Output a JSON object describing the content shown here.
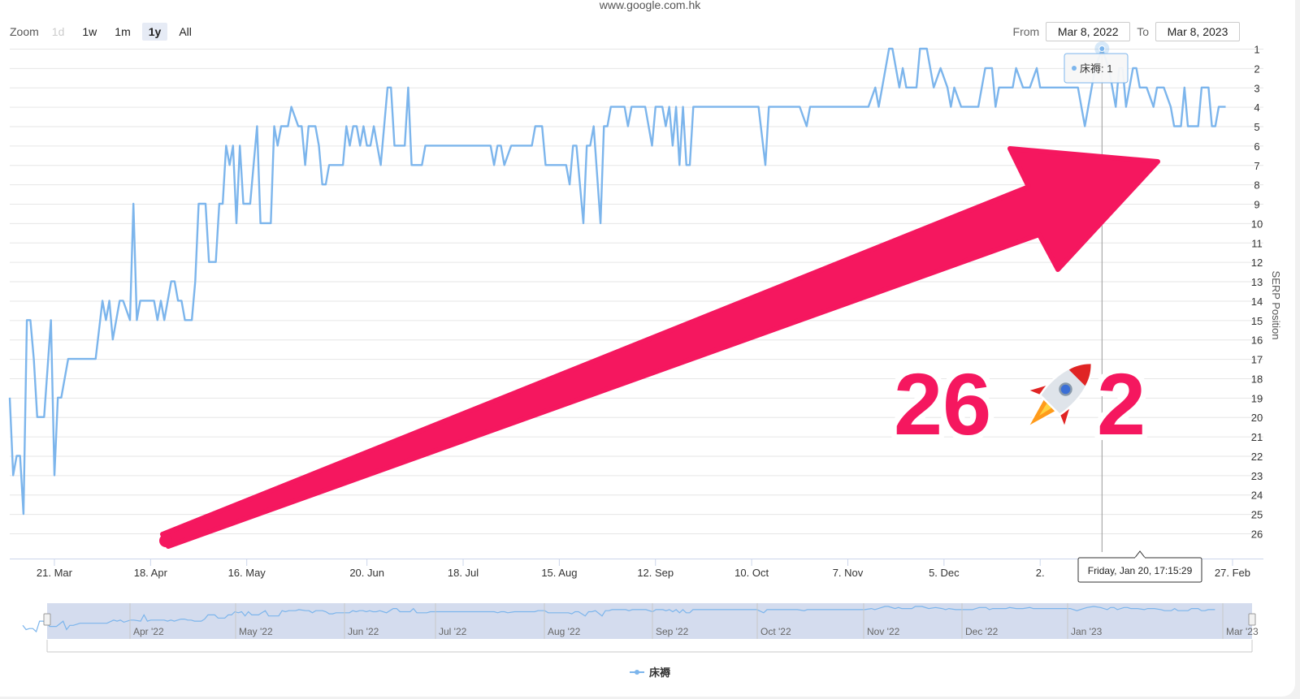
{
  "site_title": "www.google.com.hk",
  "zoom": {
    "label": "Zoom",
    "buttons": [
      {
        "label": "1d",
        "state": "disabled"
      },
      {
        "label": "1w",
        "state": "normal"
      },
      {
        "label": "1m",
        "state": "normal"
      },
      {
        "label": "1y",
        "state": "active"
      },
      {
        "label": "All",
        "state": "normal"
      }
    ]
  },
  "range": {
    "from_label": "From",
    "from_value": "Mar 8, 2022",
    "to_label": "To",
    "to_value": "Mar 8, 2023"
  },
  "tooltip": {
    "series_text": "床褥: 1",
    "date_text": "Friday, Jan 20, 17:15:29",
    "x": "2023-01-20",
    "y": 1
  },
  "overlay": {
    "left_number": "26",
    "right_number": "2",
    "rocket_icon": "rocket-icon",
    "arrow_color": "#f5175f"
  },
  "legend": {
    "label": "床褥"
  },
  "navigator": {
    "labels": [
      "Apr '22",
      "May '22",
      "Jun '22",
      "Jul '22",
      "Aug '22",
      "Sep '22",
      "Oct '22",
      "Nov '22",
      "Dec '22",
      "Jan '23",
      "Mar '23"
    ]
  },
  "chart_data": {
    "type": "line",
    "title": "",
    "ylabel": "SERP Position",
    "ylim": [
      1,
      26
    ],
    "y_reversed": true,
    "grid": true,
    "x_range": [
      "2022-03-08",
      "2023-03-08"
    ],
    "yticks": [
      1,
      2,
      3,
      4,
      5,
      6,
      7,
      8,
      9,
      10,
      11,
      12,
      13,
      14,
      15,
      16,
      17,
      18,
      19,
      20,
      21,
      22,
      23,
      24,
      25,
      26
    ],
    "xticks": [
      {
        "label": "21. Mar",
        "date": "2022-03-21"
      },
      {
        "label": "18. Apr",
        "date": "2022-04-18"
      },
      {
        "label": "16. May",
        "date": "2022-05-16"
      },
      {
        "label": "20. Jun",
        "date": "2022-06-20"
      },
      {
        "label": "18. Jul",
        "date": "2022-07-18"
      },
      {
        "label": "15. Aug",
        "date": "2022-08-15"
      },
      {
        "label": "12. Sep",
        "date": "2022-09-12"
      },
      {
        "label": "10. Oct",
        "date": "2022-10-10"
      },
      {
        "label": "7. Nov",
        "date": "2022-11-07"
      },
      {
        "label": "5. Dec",
        "date": "2022-12-05"
      },
      {
        "label": "2.",
        "date": "2023-01-02"
      },
      {
        "label": "27. Feb",
        "date": "2023-02-27"
      }
    ],
    "series": [
      {
        "name": "床褥",
        "color": "#7cb5ec",
        "points": [
          [
            "2022-03-08",
            19
          ],
          [
            "2022-03-09",
            23
          ],
          [
            "2022-03-10",
            22
          ],
          [
            "2022-03-11",
            22
          ],
          [
            "2022-03-12",
            25
          ],
          [
            "2022-03-13",
            15
          ],
          [
            "2022-03-14",
            15
          ],
          [
            "2022-03-15",
            17
          ],
          [
            "2022-03-16",
            20
          ],
          [
            "2022-03-17",
            20
          ],
          [
            "2022-03-18",
            20
          ],
          [
            "2022-03-20",
            15
          ],
          [
            "2022-03-21",
            23
          ],
          [
            "2022-03-22",
            19
          ],
          [
            "2022-03-23",
            19
          ],
          [
            "2022-03-25",
            17
          ],
          [
            "2022-04-02",
            17
          ],
          [
            "2022-04-04",
            14
          ],
          [
            "2022-04-05",
            15
          ],
          [
            "2022-04-06",
            14
          ],
          [
            "2022-04-07",
            16
          ],
          [
            "2022-04-09",
            14
          ],
          [
            "2022-04-10",
            14
          ],
          [
            "2022-04-12",
            15
          ],
          [
            "2022-04-13",
            9
          ],
          [
            "2022-04-14",
            15
          ],
          [
            "2022-04-15",
            14
          ],
          [
            "2022-04-19",
            14
          ],
          [
            "2022-04-20",
            15
          ],
          [
            "2022-04-21",
            14
          ],
          [
            "2022-04-22",
            15
          ],
          [
            "2022-04-24",
            13
          ],
          [
            "2022-04-25",
            13
          ],
          [
            "2022-04-26",
            14
          ],
          [
            "2022-04-27",
            14
          ],
          [
            "2022-04-28",
            15
          ],
          [
            "2022-04-30",
            15
          ],
          [
            "2022-05-01",
            13
          ],
          [
            "2022-05-02",
            9
          ],
          [
            "2022-05-04",
            9
          ],
          [
            "2022-05-05",
            12
          ],
          [
            "2022-05-07",
            12
          ],
          [
            "2022-05-08",
            9
          ],
          [
            "2022-05-09",
            9
          ],
          [
            "2022-05-10",
            6
          ],
          [
            "2022-05-11",
            7
          ],
          [
            "2022-05-12",
            6
          ],
          [
            "2022-05-13",
            10
          ],
          [
            "2022-05-14",
            6
          ],
          [
            "2022-05-15",
            9
          ],
          [
            "2022-05-17",
            9
          ],
          [
            "2022-05-18",
            7
          ],
          [
            "2022-05-19",
            5
          ],
          [
            "2022-05-20",
            10
          ],
          [
            "2022-05-23",
            10
          ],
          [
            "2022-05-24",
            5
          ],
          [
            "2022-05-25",
            6
          ],
          [
            "2022-05-26",
            5
          ],
          [
            "2022-05-28",
            5
          ],
          [
            "2022-05-29",
            4
          ],
          [
            "2022-05-31",
            5
          ],
          [
            "2022-06-01",
            5
          ],
          [
            "2022-06-02",
            7
          ],
          [
            "2022-06-03",
            5
          ],
          [
            "2022-06-05",
            5
          ],
          [
            "2022-06-06",
            6
          ],
          [
            "2022-06-07",
            8
          ],
          [
            "2022-06-08",
            8
          ],
          [
            "2022-06-09",
            7
          ],
          [
            "2022-06-13",
            7
          ],
          [
            "2022-06-14",
            5
          ],
          [
            "2022-06-15",
            6
          ],
          [
            "2022-06-16",
            5
          ],
          [
            "2022-06-17",
            5
          ],
          [
            "2022-06-18",
            6
          ],
          [
            "2022-06-19",
            5
          ],
          [
            "2022-06-20",
            6
          ],
          [
            "2022-06-21",
            6
          ],
          [
            "2022-06-22",
            5
          ],
          [
            "2022-06-23",
            6
          ],
          [
            "2022-06-24",
            7
          ],
          [
            "2022-06-26",
            3
          ],
          [
            "2022-06-27",
            3
          ],
          [
            "2022-06-28",
            6
          ],
          [
            "2022-07-01",
            6
          ],
          [
            "2022-07-02",
            3
          ],
          [
            "2022-07-03",
            7
          ],
          [
            "2022-07-06",
            7
          ],
          [
            "2022-07-07",
            6
          ],
          [
            "2022-07-26",
            6
          ],
          [
            "2022-07-27",
            7
          ],
          [
            "2022-07-28",
            6
          ],
          [
            "2022-07-29",
            6
          ],
          [
            "2022-07-30",
            7
          ],
          [
            "2022-08-01",
            6
          ],
          [
            "2022-08-07",
            6
          ],
          [
            "2022-08-08",
            5
          ],
          [
            "2022-08-10",
            5
          ],
          [
            "2022-08-11",
            7
          ],
          [
            "2022-08-17",
            7
          ],
          [
            "2022-08-18",
            8
          ],
          [
            "2022-08-19",
            6
          ],
          [
            "2022-08-20",
            6
          ],
          [
            "2022-08-22",
            10
          ],
          [
            "2022-08-23",
            6
          ],
          [
            "2022-08-24",
            6
          ],
          [
            "2022-08-25",
            5
          ],
          [
            "2022-08-27",
            10
          ],
          [
            "2022-08-28",
            5
          ],
          [
            "2022-08-29",
            5
          ],
          [
            "2022-08-30",
            4
          ],
          [
            "2022-09-03",
            4
          ],
          [
            "2022-09-04",
            5
          ],
          [
            "2022-09-05",
            4
          ],
          [
            "2022-09-09",
            4
          ],
          [
            "2022-09-11",
            6
          ],
          [
            "2022-09-12",
            4
          ],
          [
            "2022-09-14",
            4
          ],
          [
            "2022-09-15",
            5
          ],
          [
            "2022-09-16",
            4
          ],
          [
            "2022-09-17",
            6
          ],
          [
            "2022-09-18",
            4
          ],
          [
            "2022-09-19",
            7
          ],
          [
            "2022-09-20",
            4
          ],
          [
            "2022-09-21",
            7
          ],
          [
            "2022-09-22",
            7
          ],
          [
            "2022-09-23",
            4
          ],
          [
            "2022-10-12",
            4
          ],
          [
            "2022-10-14",
            7
          ],
          [
            "2022-10-15",
            4
          ],
          [
            "2022-10-24",
            4
          ],
          [
            "2022-10-26",
            5
          ],
          [
            "2022-10-27",
            4
          ],
          [
            "2022-11-13",
            4
          ],
          [
            "2022-11-15",
            3
          ],
          [
            "2022-11-16",
            4
          ],
          [
            "2022-11-18",
            2
          ],
          [
            "2022-11-19",
            1
          ],
          [
            "2022-11-20",
            1
          ],
          [
            "2022-11-22",
            3
          ],
          [
            "2022-11-23",
            2
          ],
          [
            "2022-11-24",
            3
          ],
          [
            "2022-11-27",
            3
          ],
          [
            "2022-11-28",
            1
          ],
          [
            "2022-11-30",
            1
          ],
          [
            "2022-12-02",
            3
          ],
          [
            "2022-12-04",
            2
          ],
          [
            "2022-12-06",
            3
          ],
          [
            "2022-12-07",
            4
          ],
          [
            "2022-12-08",
            3
          ],
          [
            "2022-12-10",
            4
          ],
          [
            "2022-12-15",
            4
          ],
          [
            "2022-12-17",
            2
          ],
          [
            "2022-12-19",
            2
          ],
          [
            "2022-12-20",
            4
          ],
          [
            "2022-12-21",
            3
          ],
          [
            "2022-12-25",
            3
          ],
          [
            "2022-12-26",
            2
          ],
          [
            "2022-12-28",
            3
          ],
          [
            "2022-12-30",
            3
          ],
          [
            "2023-01-01",
            2
          ],
          [
            "2023-01-02",
            3
          ],
          [
            "2023-01-13",
            3
          ],
          [
            "2023-01-15",
            5
          ],
          [
            "2023-01-17",
            3
          ],
          [
            "2023-01-18",
            2
          ],
          [
            "2023-01-20",
            1
          ],
          [
            "2023-01-22",
            2
          ],
          [
            "2023-01-24",
            4
          ],
          [
            "2023-01-25",
            2
          ],
          [
            "2023-01-26",
            2
          ],
          [
            "2023-01-27",
            4
          ],
          [
            "2023-01-29",
            2
          ],
          [
            "2023-01-30",
            2
          ],
          [
            "2023-01-31",
            3
          ],
          [
            "2023-02-02",
            3
          ],
          [
            "2023-02-04",
            4
          ],
          [
            "2023-02-05",
            3
          ],
          [
            "2023-02-07",
            3
          ],
          [
            "2023-02-09",
            4
          ],
          [
            "2023-02-10",
            5
          ],
          [
            "2023-02-12",
            5
          ],
          [
            "2023-02-13",
            3
          ],
          [
            "2023-02-14",
            5
          ],
          [
            "2023-02-17",
            5
          ],
          [
            "2023-02-18",
            3
          ],
          [
            "2023-02-20",
            3
          ],
          [
            "2023-02-21",
            5
          ],
          [
            "2023-02-22",
            5
          ],
          [
            "2023-02-23",
            4
          ],
          [
            "2023-02-25",
            4
          ]
        ]
      }
    ]
  }
}
